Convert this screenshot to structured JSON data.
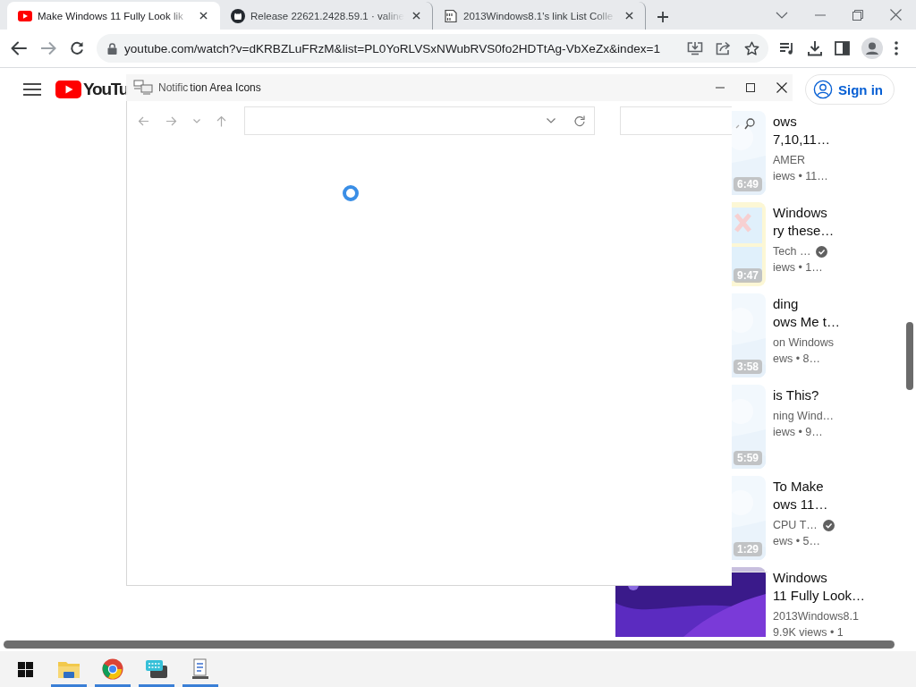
{
  "browser": {
    "tabs": [
      {
        "title": "Make Windows 11 Fully Look lik",
        "selected": true
      },
      {
        "title": "Release 22621.2428.59.1 · valine",
        "selected": false
      },
      {
        "title": "2013Windows8.1's link List Colle",
        "selected": false
      }
    ],
    "url": "youtube.com/watch?v=dKRBZLuFRzM&list=PL0YoRLVSxNWubRVS0fo2HDTtAg-VbXeZx&index=1"
  },
  "page": {
    "logo_text": "YouTu",
    "sign_in": "Sign in",
    "suggestions": [
      {
        "title_lines": [
          "ows",
          "7,10,11…"
        ],
        "channel": "AMER",
        "verified": false,
        "meta": "iews • 11…",
        "duration": "6:49"
      },
      {
        "title_lines": [
          "Windows",
          "ry these…"
        ],
        "channel": "Tech …",
        "verified": true,
        "meta": "iews • 1…",
        "duration": "9:47"
      },
      {
        "title_lines": [
          "ding",
          "ows Me t…"
        ],
        "channel": "on Windows",
        "verified": false,
        "meta": "ews • 8…",
        "duration": "3:58"
      },
      {
        "title_lines": [
          "is This?"
        ],
        "channel": "ning Wind…",
        "verified": false,
        "meta": "iews • 9…",
        "duration": "5:59"
      },
      {
        "title_lines": [
          "To Make",
          "ows 11…"
        ],
        "channel": "CPU T…",
        "verified": true,
        "meta": "ews • 5…",
        "duration": "1:29"
      },
      {
        "title_lines": [
          "Windows",
          "11 Fully Look…"
        ],
        "channel": "2013Windows8.1",
        "verified": false,
        "meta": "9.9K views • 1"
      }
    ]
  },
  "dialog": {
    "title_parts": [
      "Notific",
      "tion Area Icons"
    ]
  },
  "taskbar": {
    "apps": [
      {
        "kind": "start",
        "running": false
      },
      {
        "kind": "folder",
        "running": true
      },
      {
        "kind": "browser",
        "running": true
      },
      {
        "kind": "keyboard",
        "running": true
      },
      {
        "kind": "document",
        "running": true
      }
    ]
  }
}
